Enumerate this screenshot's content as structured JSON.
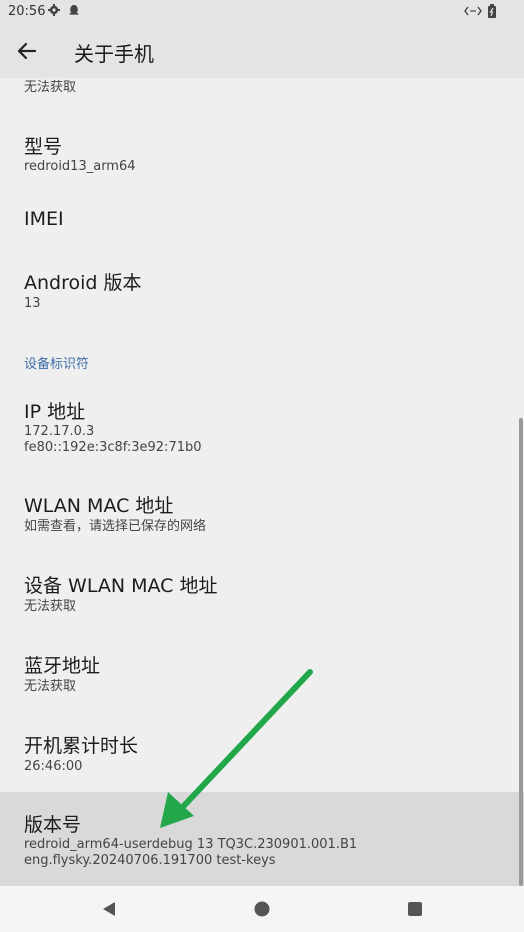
{
  "status_bar": {
    "time": "20:56",
    "icons": [
      "gear-icon",
      "notification-icon",
      "network-icon",
      "battery-icon"
    ]
  },
  "app_bar": {
    "title": "关于手机",
    "back_icon": "arrow-left-icon"
  },
  "rows": {
    "prev_partial": {
      "subtitle": "无法获取"
    },
    "model": {
      "title": "型号",
      "subtitle": "redroid13_arm64"
    },
    "imei": {
      "title": "IMEI"
    },
    "android_version": {
      "title": "Android 版本",
      "subtitle": "13"
    },
    "section_device_ids": "设备标识符",
    "ip_address": {
      "title": "IP 地址",
      "subtitle_1": "172.17.0.3",
      "subtitle_2": "fe80::192e:3c8f:3e92:71b0"
    },
    "wlan_mac": {
      "title": "WLAN MAC 地址",
      "subtitle": "如需查看，请选择已保存的网络"
    },
    "device_wlan_mac": {
      "title": "设备 WLAN MAC 地址",
      "subtitle": "无法获取"
    },
    "bluetooth": {
      "title": "蓝牙地址",
      "subtitle": "无法获取"
    },
    "uptime": {
      "title": "开机累计时长",
      "subtitle": "26:46:00"
    },
    "build_number": {
      "title": "版本号",
      "subtitle_1": "redroid_arm64-userdebug 13 TQ3C.230901.001.B1",
      "subtitle_2": "eng.flysky.20240706.191700 test-keys"
    }
  },
  "nav_bar": {
    "icons": [
      "nav-back-icon",
      "nav-home-icon",
      "nav-recents-icon"
    ]
  },
  "colors": {
    "accent_section": "#3e6ea8",
    "highlight_row": "#d9d9d9",
    "annotation_arrow": "#22a84a"
  }
}
